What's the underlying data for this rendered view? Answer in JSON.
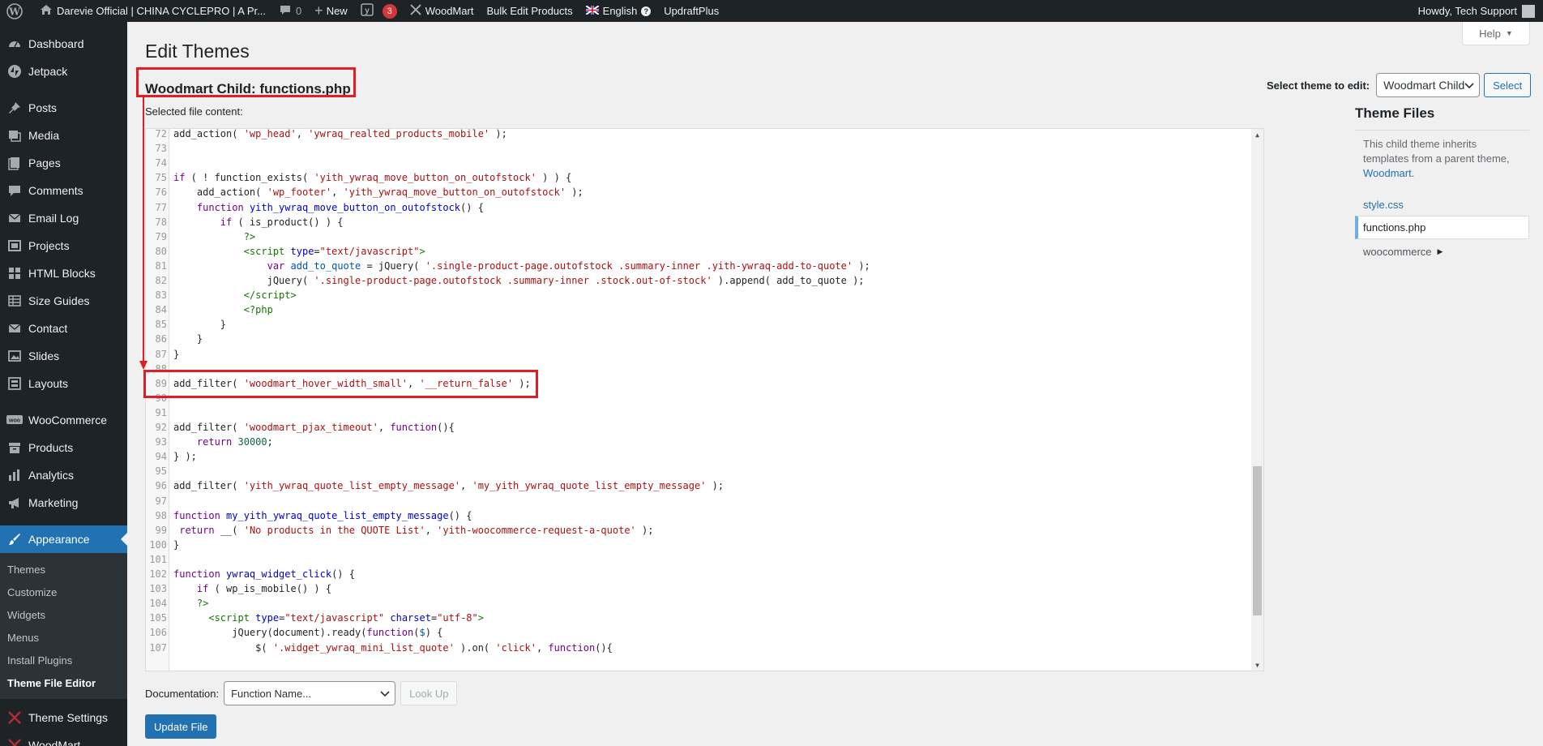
{
  "adminbar": {
    "site_title": "Darevie Official | CHINA CYCLEPRO | A Pr...",
    "comments_count": "0",
    "new_label": "New",
    "yoast_count": "3",
    "woodmart_label": "WoodMart",
    "bulk_edit_label": "Bulk Edit Products",
    "language_label": "English",
    "updraft_label": "UpdraftPlus",
    "howdy": "Howdy, Tech Support"
  },
  "sidebar": {
    "items": [
      {
        "label": "Dashboard",
        "icon": "dashboard-icon"
      },
      {
        "label": "Jetpack",
        "icon": "jetpack-icon"
      },
      {
        "label": "Posts",
        "icon": "pin-icon"
      },
      {
        "label": "Media",
        "icon": "media-icon"
      },
      {
        "label": "Pages",
        "icon": "pages-icon"
      },
      {
        "label": "Comments",
        "icon": "comment-icon"
      },
      {
        "label": "Email Log",
        "icon": "email-icon"
      },
      {
        "label": "Projects",
        "icon": "projects-icon"
      },
      {
        "label": "HTML Blocks",
        "icon": "grid-icon"
      },
      {
        "label": "Size Guides",
        "icon": "table-icon"
      },
      {
        "label": "Contact",
        "icon": "email-icon"
      },
      {
        "label": "Slides",
        "icon": "slides-icon"
      },
      {
        "label": "Layouts",
        "icon": "layouts-icon"
      },
      {
        "label": "WooCommerce",
        "icon": "woo-icon"
      },
      {
        "label": "Products",
        "icon": "archive-icon"
      },
      {
        "label": "Analytics",
        "icon": "chart-icon"
      },
      {
        "label": "Marketing",
        "icon": "megaphone-icon"
      },
      {
        "label": "Appearance",
        "icon": "brush-icon"
      }
    ],
    "submenu": [
      "Themes",
      "Customize",
      "Widgets",
      "Menus",
      "Install Plugins",
      "Theme File Editor"
    ],
    "after": [
      {
        "label": "Theme Settings",
        "icon": "settings-icon"
      },
      {
        "label": "WoodMart",
        "icon": "woodmart-icon"
      }
    ]
  },
  "main": {
    "help_label": "Help",
    "page_title": "Edit Themes",
    "file_heading": "Woodmart Child: functions.php",
    "select_theme_label": "Select theme to edit:",
    "select_theme_value": "Woodmart Child",
    "select_button": "Select",
    "selected_content_label": "Selected file content:",
    "documentation_label": "Documentation:",
    "function_name_placeholder": "Function Name...",
    "lookup_button": "Look Up",
    "update_button": "Update File"
  },
  "theme_files": {
    "heading": "Theme Files",
    "desc": "This child theme inherits templates from a parent theme,",
    "parent_link": "Woodmart",
    "files": [
      "style.css",
      "functions.php"
    ],
    "current_file": "functions.php",
    "folder": "woocommerce"
  },
  "code_lines": [
    {
      "n": "72",
      "html": "add_action( <span class=\"str\">'wp_head'</span>, <span class=\"str\">'ywraq_realted_products_mobile'</span> );"
    },
    {
      "n": "73",
      "html": ""
    },
    {
      "n": "74",
      "html": ""
    },
    {
      "n": "75",
      "html": "<span class=\"kw\">if</span> ( ! function_exists( <span class=\"str\">'yith_ywraq_move_button_on_outofstock'</span> ) ) {"
    },
    {
      "n": "76",
      "html": "    add_action( <span class=\"str\">'wp_footer'</span>, <span class=\"str\">'yith_ywraq_move_button_on_outofstock'</span> );"
    },
    {
      "n": "77",
      "html": "    <span class=\"kw\">function</span> <span class=\"fn\">yith_ywraq_move_button_on_outofstock</span>() {"
    },
    {
      "n": "78",
      "html": "        <span class=\"kw\">if</span> ( is_product() ) {"
    },
    {
      "n": "79",
      "html": "            <span class=\"tag\">?&gt;</span>"
    },
    {
      "n": "80",
      "html": "            <span class=\"tag\">&lt;script</span> <span class=\"att\">type</span>=<span class=\"str\">\"text/javascript\"</span><span class=\"tag\">&gt;</span>"
    },
    {
      "n": "81",
      "html": "                <span class=\"kw\">var</span> <span class=\"var2\">add_to_quote</span> = jQuery( <span class=\"str\">'.single-product-page.outofstock .summary-inner .yith-ywraq-add-to-quote'</span> );"
    },
    {
      "n": "82",
      "html": "                jQuery( <span class=\"str\">'.single-product-page.outofstock .summary-inner .stock.out-of-stock'</span> ).append( add_to_quote );"
    },
    {
      "n": "83",
      "html": "            <span class=\"tag\">&lt;/script&gt;</span>"
    },
    {
      "n": "84",
      "html": "            <span class=\"tag\">&lt;?php</span>"
    },
    {
      "n": "85",
      "html": "        }"
    },
    {
      "n": "86",
      "html": "    }"
    },
    {
      "n": "87",
      "html": "}"
    },
    {
      "n": "88",
      "html": ""
    },
    {
      "n": "89",
      "html": "add_filter( <span class=\"str\">'woodmart_hover_width_small'</span>, <span class=\"str\">'__return_false'</span> );"
    },
    {
      "n": "90",
      "html": ""
    },
    {
      "n": "91",
      "html": ""
    },
    {
      "n": "92",
      "html": "add_filter( <span class=\"str\">'woodmart_pjax_timeout'</span>, <span class=\"kw\">function</span>(){"
    },
    {
      "n": "93",
      "html": "    <span class=\"kw\">return</span> <span class=\"num\">30000</span>;"
    },
    {
      "n": "94",
      "html": "} );"
    },
    {
      "n": "95",
      "html": ""
    },
    {
      "n": "96",
      "html": "add_filter( <span class=\"str\">'yith_ywraq_quote_list_empty_message'</span>, <span class=\"str\">'my_yith_ywraq_quote_list_empty_message'</span> );"
    },
    {
      "n": "97",
      "html": ""
    },
    {
      "n": "98",
      "html": "<span class=\"kw\">function</span> <span class=\"fn\">my_yith_ywraq_quote_list_empty_message</span>() {"
    },
    {
      "n": "99",
      "html": " <span class=\"kw\">return</span> __( <span class=\"str\">'No products in the QUOTE List'</span>, <span class=\"str\">'yith-woocommerce-request-a-quote'</span> );"
    },
    {
      "n": "100",
      "html": "}"
    },
    {
      "n": "101",
      "html": ""
    },
    {
      "n": "102",
      "html": "<span class=\"kw\">function</span> <span class=\"fn\">ywraq_widget_click</span>() {"
    },
    {
      "n": "103",
      "html": "    <span class=\"kw\">if</span> ( wp_is_mobile() ) {"
    },
    {
      "n": "104",
      "html": "    <span class=\"tag\">?&gt;</span>"
    },
    {
      "n": "105",
      "html": "      <span class=\"tag\">&lt;script</span> <span class=\"att\">type</span>=<span class=\"str\">\"text/javascript\"</span> <span class=\"att\">charset</span>=<span class=\"str\">\"utf-8\"</span><span class=\"tag\">&gt;</span>"
    },
    {
      "n": "106",
      "html": "          jQuery(document).ready(<span class=\"kw\">function</span>(<span class=\"var2\">$</span>) {"
    },
    {
      "n": "107",
      "html": "              $( <span class=\"str\">'.widget_ywraq_mini_list_quote'</span> ).on( <span class=\"str\">'click'</span>, <span class=\"kw\">function</span>(){"
    }
  ]
}
